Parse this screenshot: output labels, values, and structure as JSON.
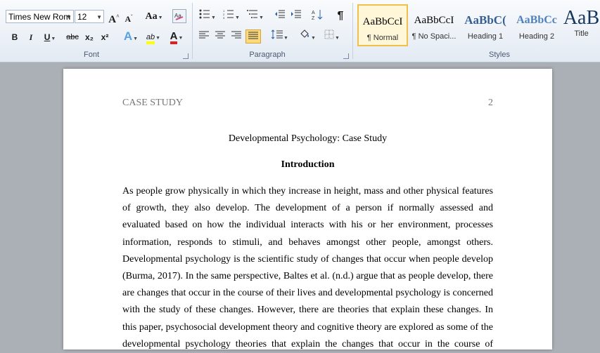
{
  "ribbon": {
    "font": {
      "group_label": "Font",
      "font_name": "Times New Rom",
      "font_size": "12",
      "grow_label": "A",
      "shrink_label": "A",
      "change_case_label": "Aa",
      "bold": "B",
      "italic": "I",
      "underline": "U",
      "strike": "abc",
      "subscript": "x₂",
      "superscript": "x²",
      "text_effects": "A",
      "highlight": "ab",
      "font_color": "A",
      "font_color_value": "#e02020",
      "highlight_color_value": "#ffff00"
    },
    "paragraph": {
      "group_label": "Paragraph",
      "show_marks": "¶"
    },
    "styles": {
      "group_label": "Styles",
      "items": [
        {
          "sample": "AaBbCcI",
          "name": "¶ Normal"
        },
        {
          "sample": "AaBbCcI",
          "name": "¶ No Spaci..."
        },
        {
          "sample": "AaBbC(",
          "name": "Heading 1"
        },
        {
          "sample": "AaBbCc",
          "name": "Heading 2"
        },
        {
          "sample": "AaB",
          "name": "Title"
        }
      ]
    }
  },
  "document": {
    "header_left": "CASE STUDY",
    "header_right": "2",
    "title": "Developmental Psychology: Case Study",
    "heading": "Introduction",
    "paragraph_lines": [
      "As people grow physically in which they increase in height, mass and other physical features",
      "of growth, they also develop. The development of a person if normally assessed and",
      "evaluated based on how the individual interacts with his or her environment, processes",
      "information, responds to stimuli, and behaves amongst other people, amongst others.",
      "Developmental psychology is the scientific study of changes that occur when people develop",
      "(Burma, 2017). In the same perspective, Baltes et al. (n.d.) argue that as people develop, there",
      "are changes that occur in the course of their lives and developmental psychology is concerned",
      "with the study of these changes. However, there are theories that explain these changes. In",
      "this paper, psychosocial development theory and cognitive theory are explored as some of the",
      "developmental psychology theories that explain the changes that occur in the course of"
    ]
  }
}
